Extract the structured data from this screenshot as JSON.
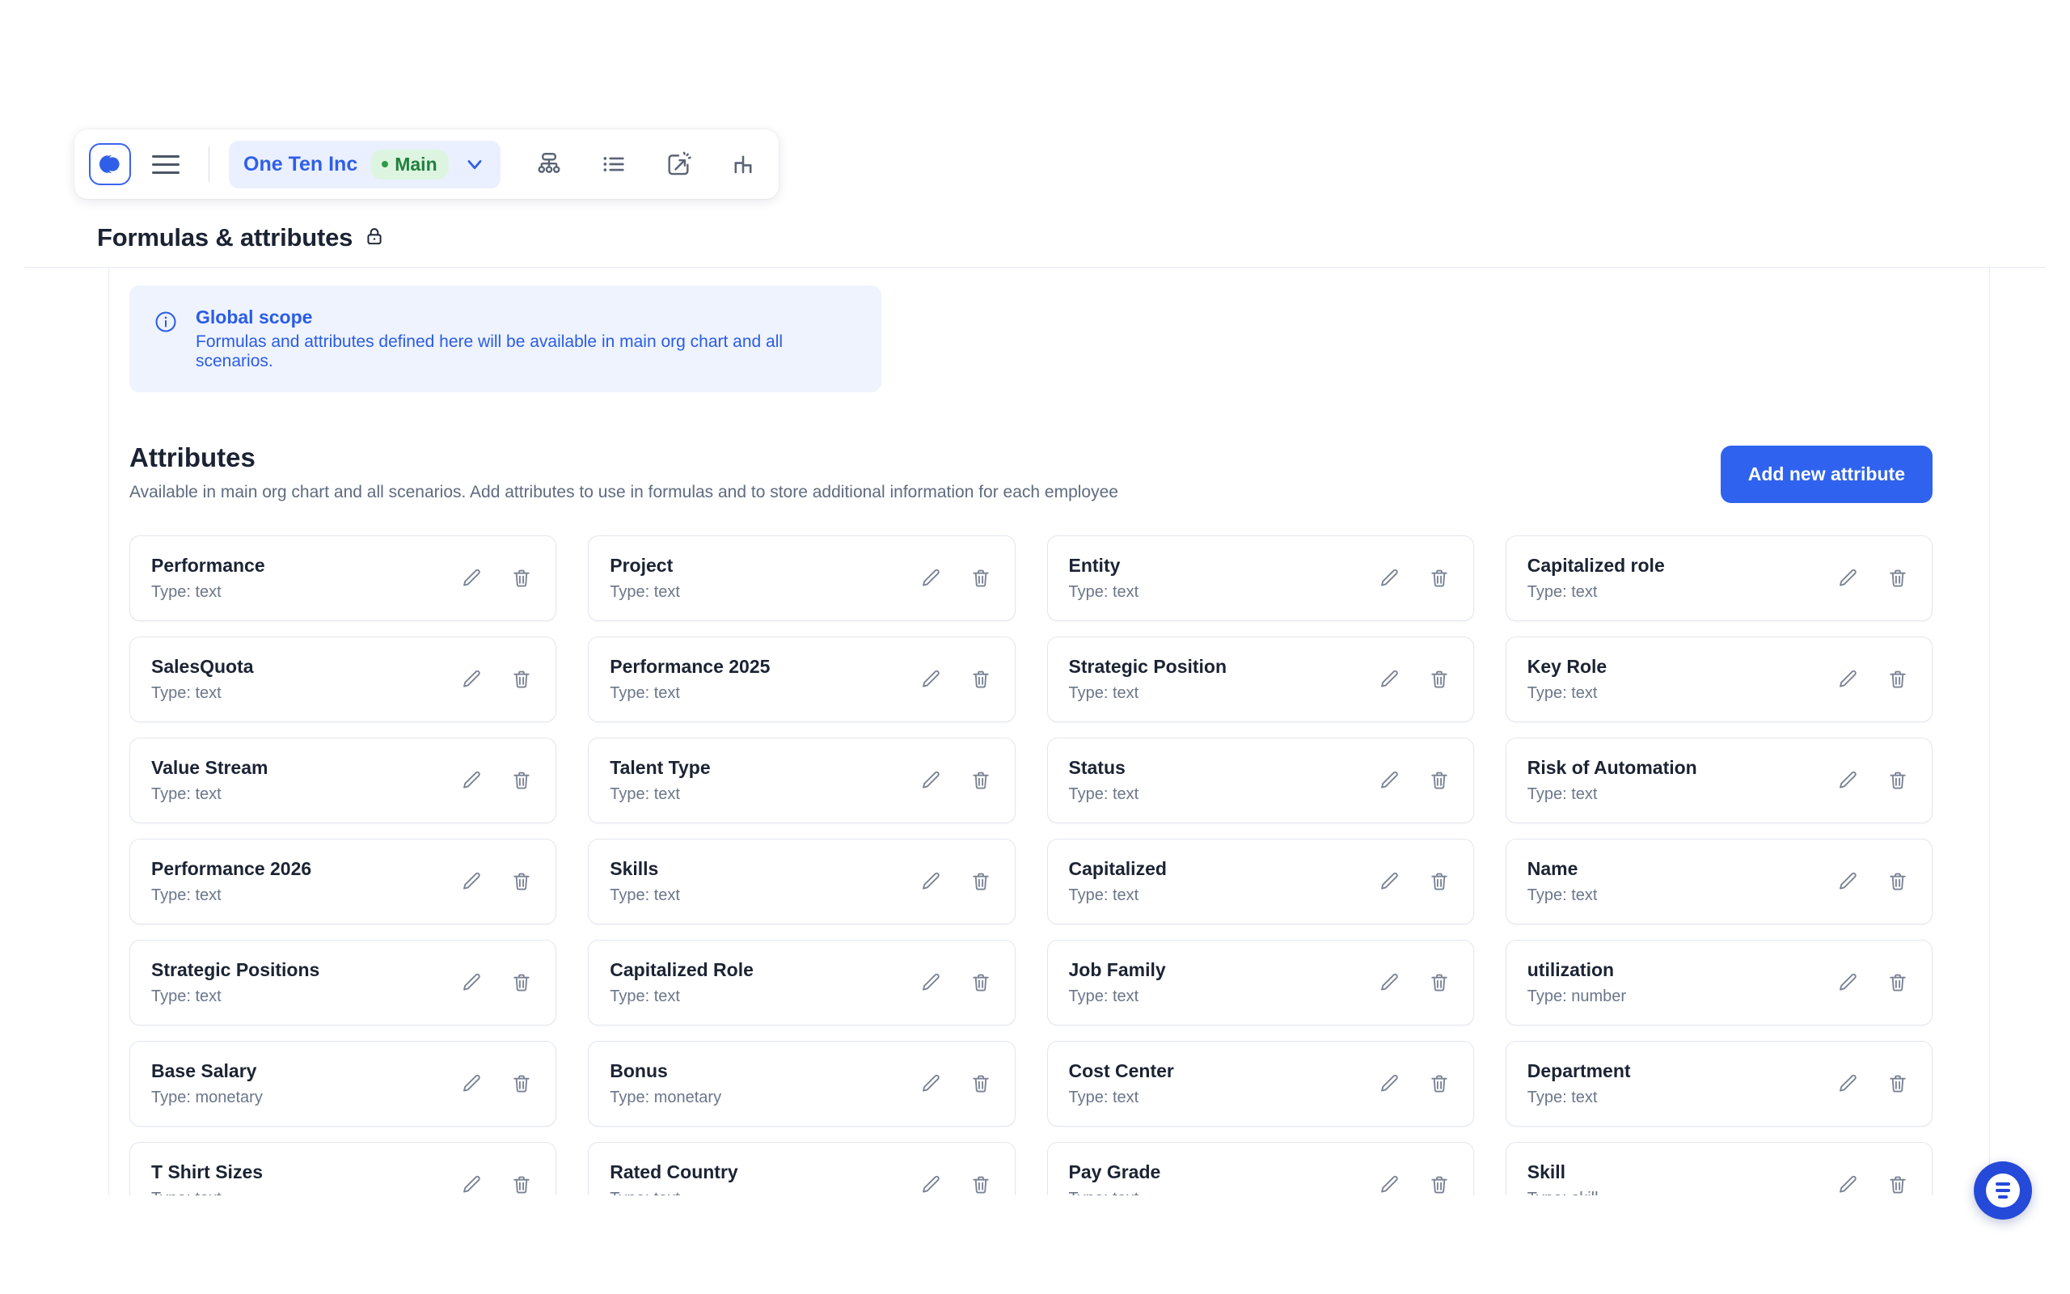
{
  "topbar": {
    "logo_icon": "app-logo-icon",
    "menu_icon": "hamburger-menu-icon",
    "org_name": "One Ten Inc",
    "branch_label": "Main",
    "chevron_icon": "chevron-down-icon",
    "tools": [
      {
        "name": "org-chart-icon",
        "label": "Org chart"
      },
      {
        "name": "list-view-icon",
        "label": "List"
      },
      {
        "name": "scenario-icon",
        "label": "Scenarios"
      },
      {
        "name": "analytics-icon",
        "label": "Analytics"
      }
    ]
  },
  "page": {
    "title": "Formulas & attributes",
    "lock_icon": "lock-icon"
  },
  "banner": {
    "icon": "info-icon",
    "title": "Global scope",
    "description": "Formulas and attributes defined here will be available in main org chart and all scenarios."
  },
  "section": {
    "title": "Attributes",
    "subtitle": "Available in main org chart and all scenarios. Add attributes to use in formulas and to store additional information for each employee",
    "add_button_label": "Add new attribute"
  },
  "card_actions": {
    "edit_icon": "pencil-icon",
    "delete_icon": "trash-icon"
  },
  "attributes": [
    {
      "name": "Performance",
      "type": "Type: text"
    },
    {
      "name": "Project",
      "type": "Type: text"
    },
    {
      "name": "Entity",
      "type": "Type: text"
    },
    {
      "name": "Capitalized role",
      "type": "Type: text"
    },
    {
      "name": "SalesQuota",
      "type": "Type: text"
    },
    {
      "name": "Performance 2025",
      "type": "Type: text"
    },
    {
      "name": "Strategic Position",
      "type": "Type: text"
    },
    {
      "name": "Key Role",
      "type": "Type: text"
    },
    {
      "name": "Value Stream",
      "type": "Type: text"
    },
    {
      "name": "Talent Type",
      "type": "Type: text"
    },
    {
      "name": "Status",
      "type": "Type: text"
    },
    {
      "name": "Risk of Automation",
      "type": "Type: text"
    },
    {
      "name": "Performance 2026",
      "type": "Type: text"
    },
    {
      "name": "Skills",
      "type": "Type: text"
    },
    {
      "name": "Capitalized",
      "type": "Type: text"
    },
    {
      "name": "Name",
      "type": "Type: text"
    },
    {
      "name": "Strategic Positions",
      "type": "Type: text"
    },
    {
      "name": "Capitalized Role",
      "type": "Type: text"
    },
    {
      "name": "Job Family",
      "type": "Type: text"
    },
    {
      "name": "utilization",
      "type": "Type: number"
    },
    {
      "name": "Base Salary",
      "type": "Type: monetary"
    },
    {
      "name": "Bonus",
      "type": "Type: monetary"
    },
    {
      "name": "Cost Center",
      "type": "Type: text"
    },
    {
      "name": "Department",
      "type": "Type: text"
    },
    {
      "name": "T Shirt Sizes",
      "type": "Type: text"
    },
    {
      "name": "Rated Country",
      "type": "Type: text"
    },
    {
      "name": "Pay Grade",
      "type": "Type: text"
    },
    {
      "name": "Skill",
      "type": "Type: skill"
    }
  ],
  "chat": {
    "icon": "chat-support-icon"
  },
  "colors": {
    "accent_blue": "#2f63ef",
    "org_blue": "#2f5fe8",
    "branch_green": "#21813f",
    "banner_bg": "#eef3fe",
    "text_dark": "#1b2333",
    "text_muted": "#6b7689"
  }
}
